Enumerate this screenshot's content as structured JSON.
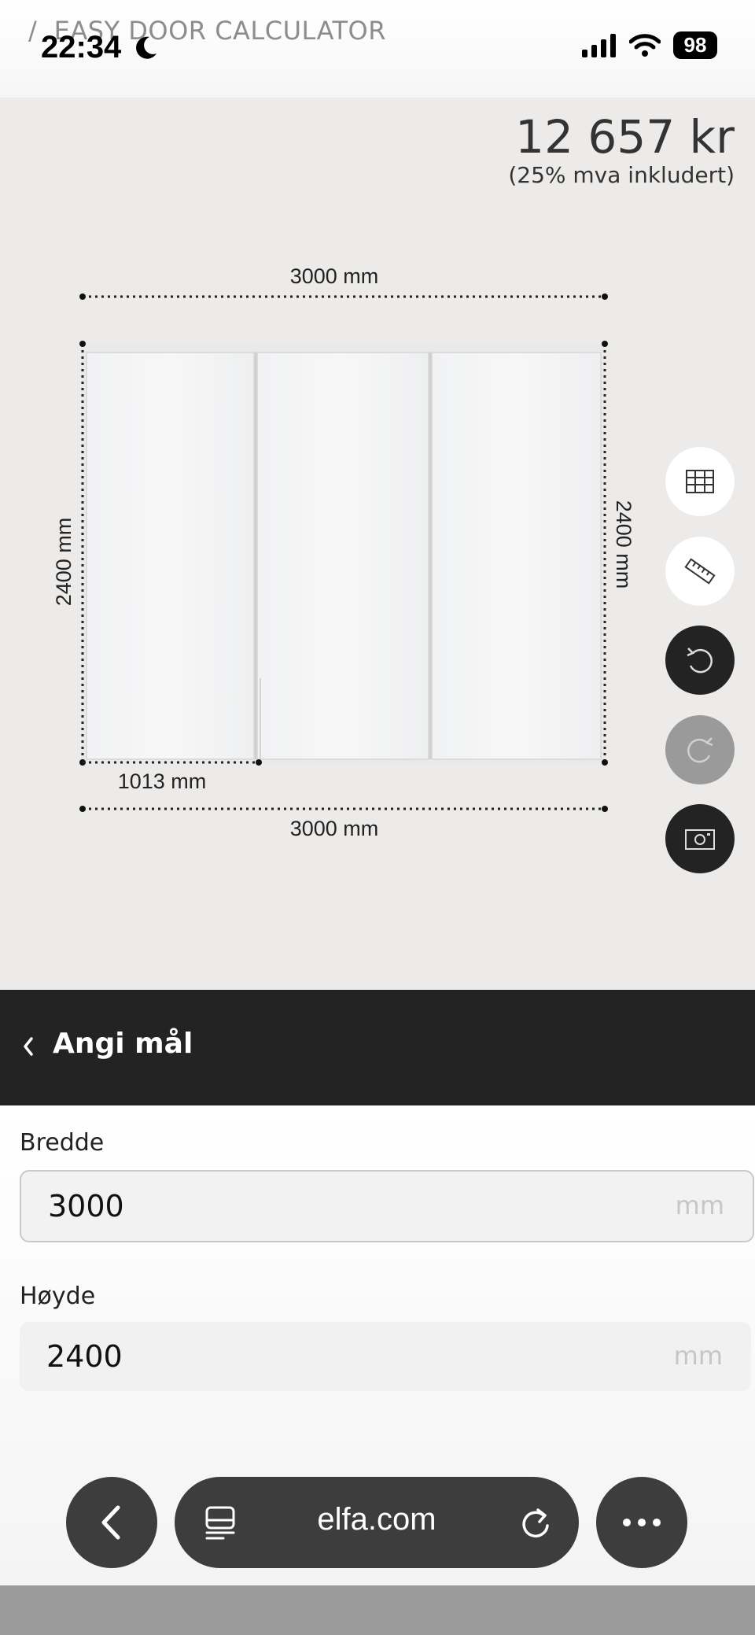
{
  "status_bar": {
    "time": "22:34",
    "battery": "98"
  },
  "breadcrumb": {
    "separator": "/",
    "title": "EASY DOOR CALCULATOR"
  },
  "price": {
    "amount": "12 657 kr",
    "vat_note": "(25% mva inkludert)"
  },
  "drawing": {
    "width_top": "3000 mm",
    "width_bottom": "3000 mm",
    "height_left": "2400 mm",
    "height_right": "2400 mm",
    "door_width": "1013 mm",
    "door_count": 3
  },
  "tools": [
    {
      "icon": "grid-icon",
      "style": "white"
    },
    {
      "icon": "ruler-icon",
      "style": "white"
    },
    {
      "icon": "undo-icon",
      "style": "dark"
    },
    {
      "icon": "redo-icon",
      "style": "grey-disabled"
    },
    {
      "icon": "camera-icon",
      "style": "dark"
    }
  ],
  "panel": {
    "title": "Angi mål"
  },
  "form": {
    "width": {
      "label": "Bredde",
      "value": "3000",
      "unit": "mm"
    },
    "height": {
      "label": "Høyde",
      "value": "2400",
      "unit": "mm"
    }
  },
  "browser": {
    "url": "elfa.com"
  }
}
